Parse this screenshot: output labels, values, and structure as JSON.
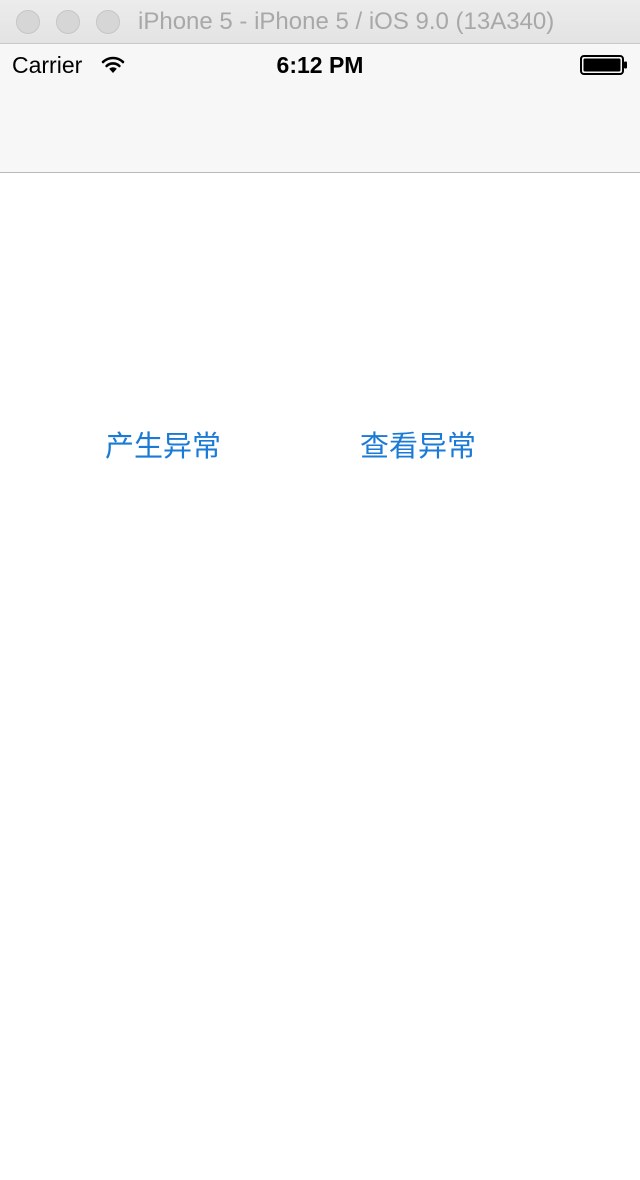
{
  "window": {
    "title": "iPhone 5 - iPhone 5 / iOS 9.0 (13A340)"
  },
  "status_bar": {
    "carrier": "Carrier",
    "time": "6:12 PM",
    "wifi_icon": "wifi-icon",
    "battery_icon": "battery-icon"
  },
  "buttons": {
    "produce_exception": "产生异常",
    "view_exception": "查看异常"
  },
  "colors": {
    "tint": "#1a7ad6",
    "nav_background": "#f7f7f7"
  }
}
